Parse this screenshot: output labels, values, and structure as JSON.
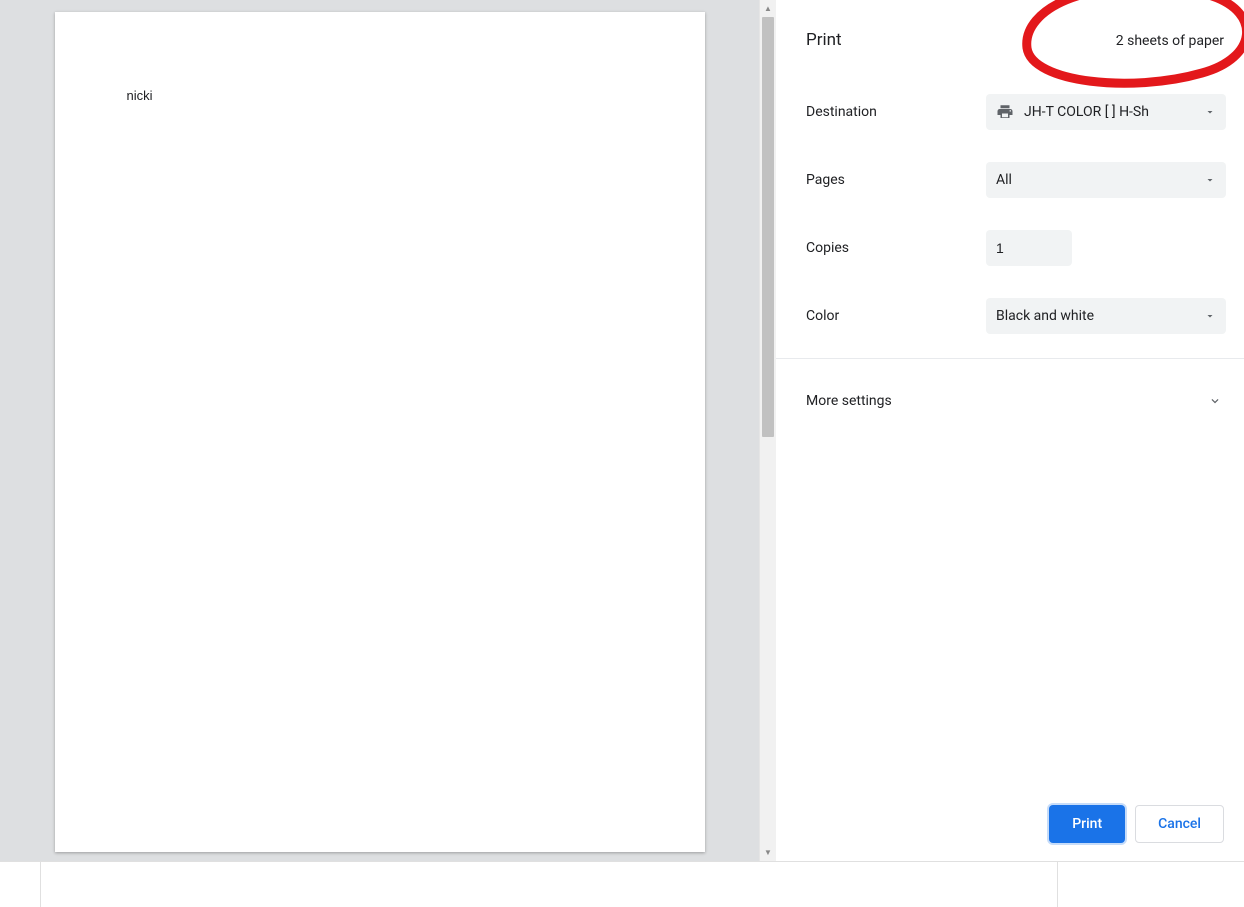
{
  "preview": {
    "document_text": "nicki"
  },
  "header": {
    "title": "Print",
    "summary": "2 sheets of paper"
  },
  "settings": {
    "destination": {
      "label": "Destination",
      "value": "JH-T COLOR [   ] H-Sh"
    },
    "pages": {
      "label": "Pages",
      "value": "All"
    },
    "copies": {
      "label": "Copies",
      "value": "1"
    },
    "color": {
      "label": "Color",
      "value": "Black and white"
    }
  },
  "more_settings": {
    "label": "More settings"
  },
  "footer": {
    "print": "Print",
    "cancel": "Cancel"
  }
}
